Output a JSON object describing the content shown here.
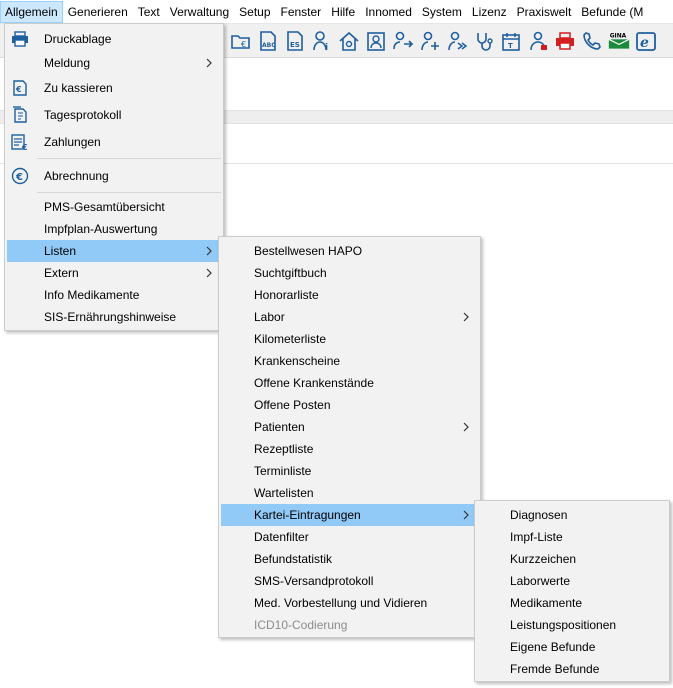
{
  "menubar": {
    "items": [
      "Allgemein",
      "Generieren",
      "Text",
      "Verwaltung",
      "Setup",
      "Fenster",
      "Hilfe",
      "Innomed",
      "System",
      "Lizenz",
      "Praxiswelt",
      "Befunde (M"
    ]
  },
  "toolbar": {
    "gina_label": "GINA"
  },
  "menu_main": {
    "items": [
      {
        "label": "Druckablage",
        "icon": "printer-icon"
      },
      {
        "label": "Meldung",
        "submenu": true
      },
      {
        "label": "Zu kassieren",
        "icon": "cash-register-icon"
      },
      {
        "label": "Tagesprotokoll",
        "icon": "day-protocol-icon"
      },
      {
        "label": "Zahlungen",
        "icon": "payments-icon"
      },
      {
        "label": "Abrechnung",
        "icon": "euro-icon"
      },
      {
        "label": "PMS-Gesamtübersicht"
      },
      {
        "label": "Impfplan-Auswertung"
      },
      {
        "label": "Listen",
        "submenu": true,
        "highlighted": true
      },
      {
        "label": "Extern",
        "submenu": true
      },
      {
        "label": "Info Medikamente"
      },
      {
        "label": "SIS-Ernährungshinweise"
      }
    ]
  },
  "menu_listen": {
    "items": [
      {
        "label": "Bestellwesen HAPO"
      },
      {
        "label": "Suchtgiftbuch"
      },
      {
        "label": "Honorarliste"
      },
      {
        "label": "Labor",
        "submenu": true
      },
      {
        "label": "Kilometerliste"
      },
      {
        "label": "Krankenscheine"
      },
      {
        "label": "Offene Krankenstände"
      },
      {
        "label": "Offene Posten"
      },
      {
        "label": "Patienten",
        "submenu": true
      },
      {
        "label": "Rezeptliste"
      },
      {
        "label": "Terminliste"
      },
      {
        "label": "Wartelisten"
      },
      {
        "label": "Kartei-Eintragungen",
        "submenu": true,
        "highlighted": true
      },
      {
        "label": "Datenfilter"
      },
      {
        "label": "Befundstatistik"
      },
      {
        "label": "SMS-Versandprotokoll"
      },
      {
        "label": "Med. Vorbestellung und Vidieren"
      },
      {
        "label": "ICD10-Codierung",
        "disabled": true
      }
    ]
  },
  "menu_kartei": {
    "items": [
      {
        "label": "Diagnosen"
      },
      {
        "label": "Impf-Liste"
      },
      {
        "label": "Kurzzeichen"
      },
      {
        "label": "Laborwerte"
      },
      {
        "label": "Medikamente"
      },
      {
        "label": "Leistungspositionen"
      },
      {
        "label": "Eigene Befunde"
      },
      {
        "label": "Fremde Befunde"
      }
    ]
  },
  "colors": {
    "highlight": "#91c9f7",
    "menubar_active": "#cce8ff",
    "toolbar_blue": "#1f5f9e",
    "toolbar_red": "#d21f1f",
    "gina_green": "#1c8a3c",
    "disabled_text": "#8c8c8c"
  }
}
